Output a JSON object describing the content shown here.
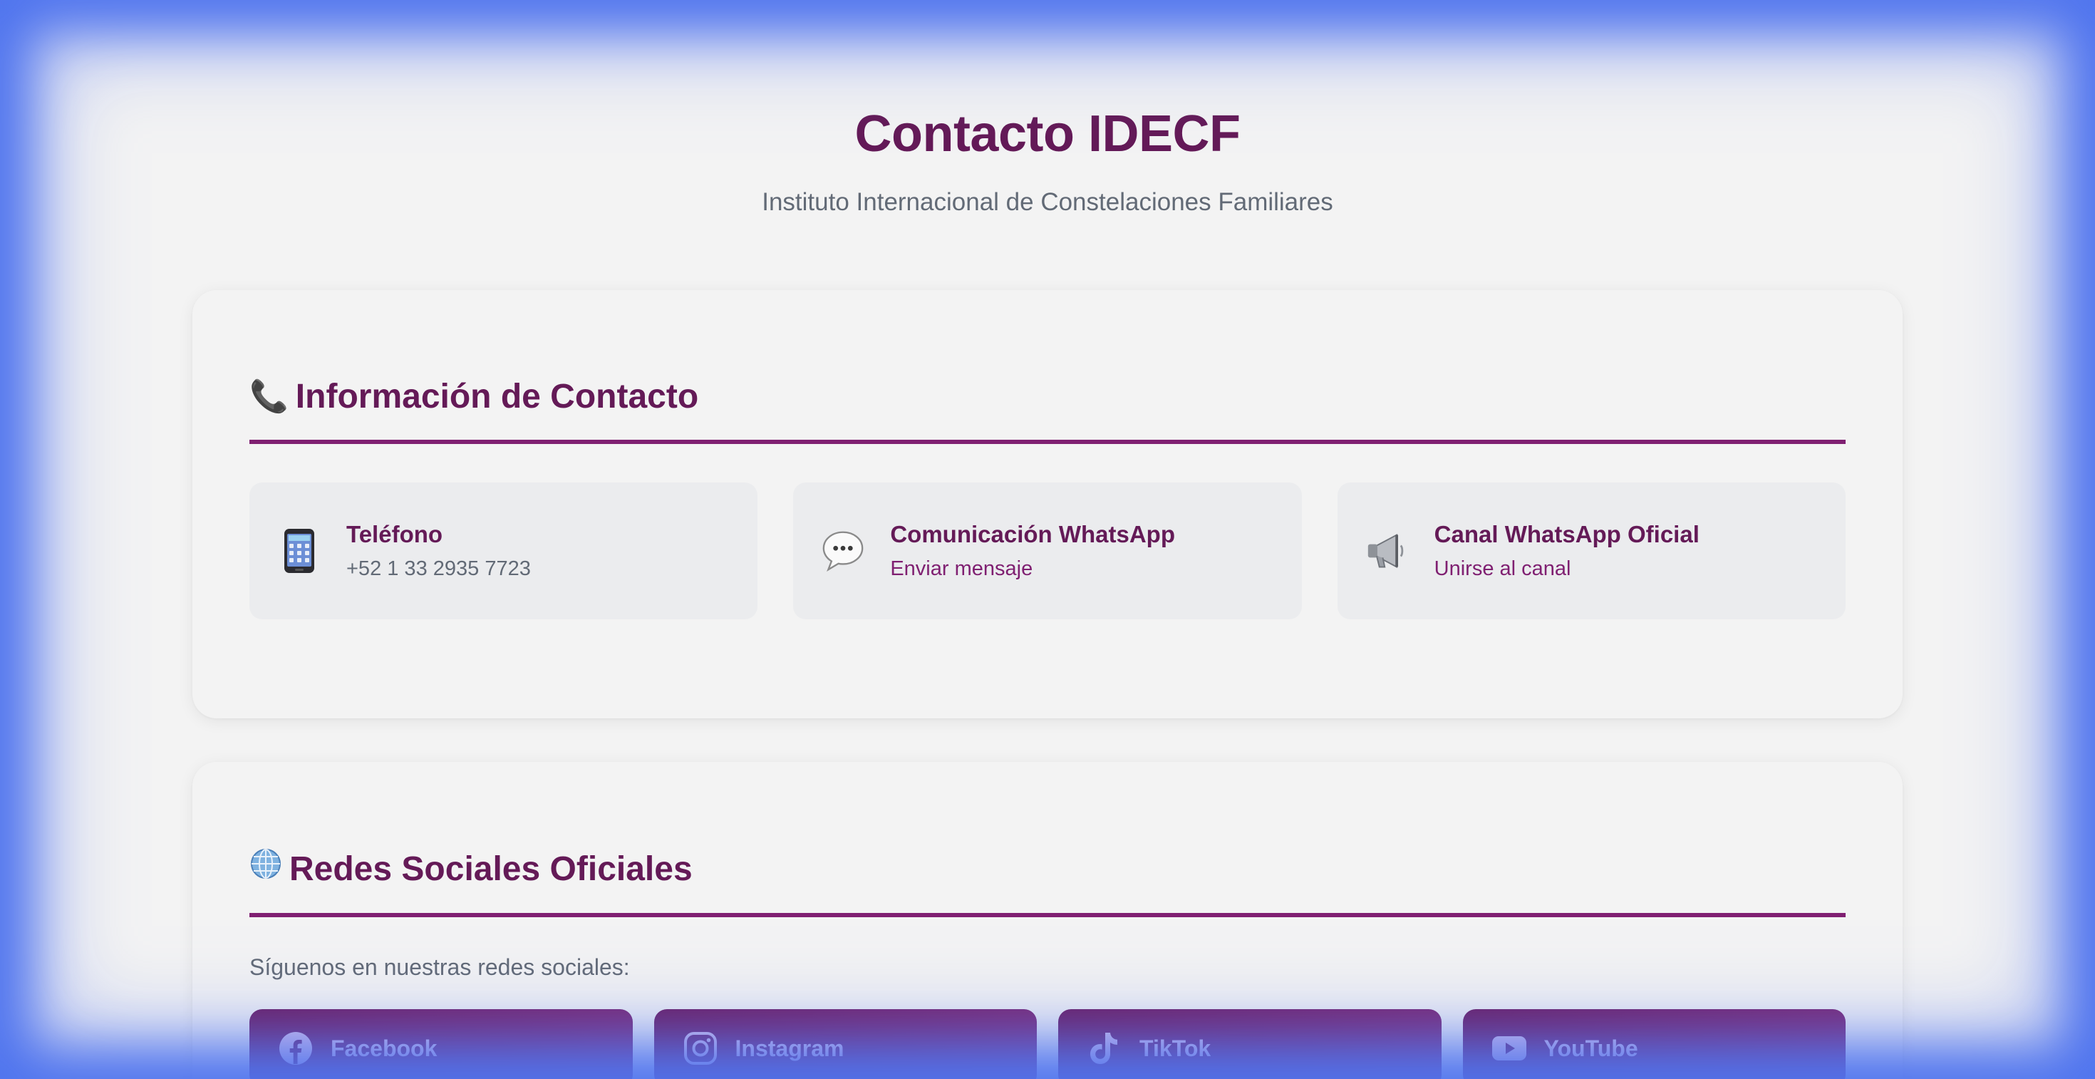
{
  "header": {
    "title": "Contacto IDECF",
    "subtitle": "Instituto Internacional de Constelaciones Familiares"
  },
  "contact_section": {
    "icon": "telephone-icon",
    "title": "Información de Contacto",
    "items": [
      {
        "icon": "mobile-phone-icon",
        "label": "Teléfono",
        "value": "+52 1 33 2935 7723"
      },
      {
        "icon": "speech-bubble-icon",
        "label": "Comunicación WhatsApp",
        "value": "Enviar mensaje"
      },
      {
        "icon": "megaphone-icon",
        "label": "Canal WhatsApp Oficial",
        "value": "Unirse al canal"
      }
    ]
  },
  "social_section": {
    "icon": "globe-icon",
    "title": "Redes Sociales Oficiales",
    "follow_text": "Síguenos en nuestras redes sociales:",
    "links": [
      {
        "icon": "facebook-icon",
        "label": "Facebook"
      },
      {
        "icon": "instagram-icon",
        "label": "Instagram"
      },
      {
        "icon": "tiktok-icon",
        "label": "TikTok"
      },
      {
        "icon": "youtube-icon",
        "label": "YouTube"
      }
    ]
  },
  "colors": {
    "brand": "#641a57",
    "accent": "#7f1f71",
    "background": "#f3f3f3",
    "frame": "#4f74ee"
  }
}
